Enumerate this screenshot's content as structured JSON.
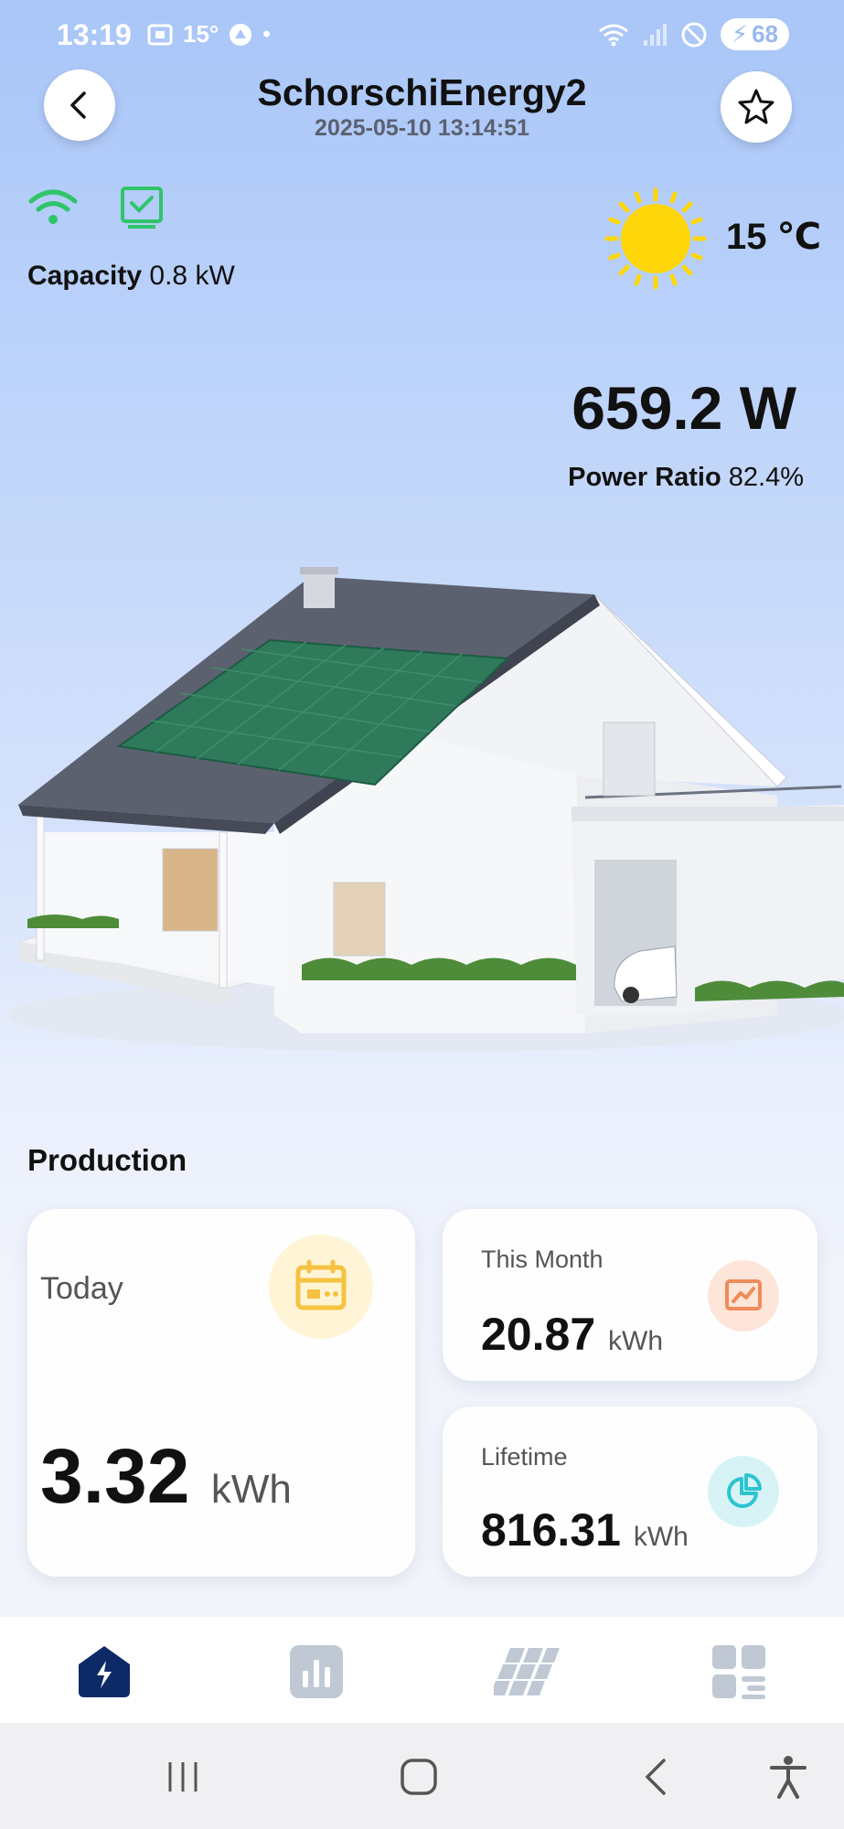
{
  "status_bar": {
    "time": "13:19",
    "temp": "15°",
    "battery": "68"
  },
  "header": {
    "title": "SchorschiEnergy2",
    "timestamp": "2025-05-10 13:14:51",
    "back_icon": "chevron-left-icon",
    "favorite_icon": "star-icon"
  },
  "device": {
    "capacity_label": "Capacity",
    "capacity_value": "0.8 kW",
    "wifi_icon": "wifi-icon",
    "inverter_icon": "inverter-check-icon"
  },
  "weather": {
    "icon": "sun-icon",
    "temperature": "15 ℃"
  },
  "power": {
    "current": "659.2 W",
    "ratio_label": "Power Ratio",
    "ratio_value": "82.4%"
  },
  "production": {
    "section_title": "Production",
    "today": {
      "label": "Today",
      "value": "3.32",
      "unit": "kWh",
      "icon": "calendar-icon"
    },
    "month": {
      "label": "This Month",
      "value": "20.87",
      "unit": "kWh",
      "icon": "trend-chart-icon"
    },
    "lifetime": {
      "label": "Lifetime",
      "value": "816.31",
      "unit": "kWh",
      "icon": "pie-chart-icon"
    }
  },
  "bottom_nav": {
    "items": [
      "home-energy-icon",
      "bar-chart-icon",
      "solar-panel-icon",
      "dashboard-grid-icon"
    ],
    "active_color": "#0d2a66",
    "inactive_color": "#c0c8d4"
  },
  "colors": {
    "wifi": "#2fc46a",
    "sun": "#ffd60a",
    "calendar": "#f5c242",
    "trend": "#f08b5a",
    "pie": "#2cc4cf"
  }
}
